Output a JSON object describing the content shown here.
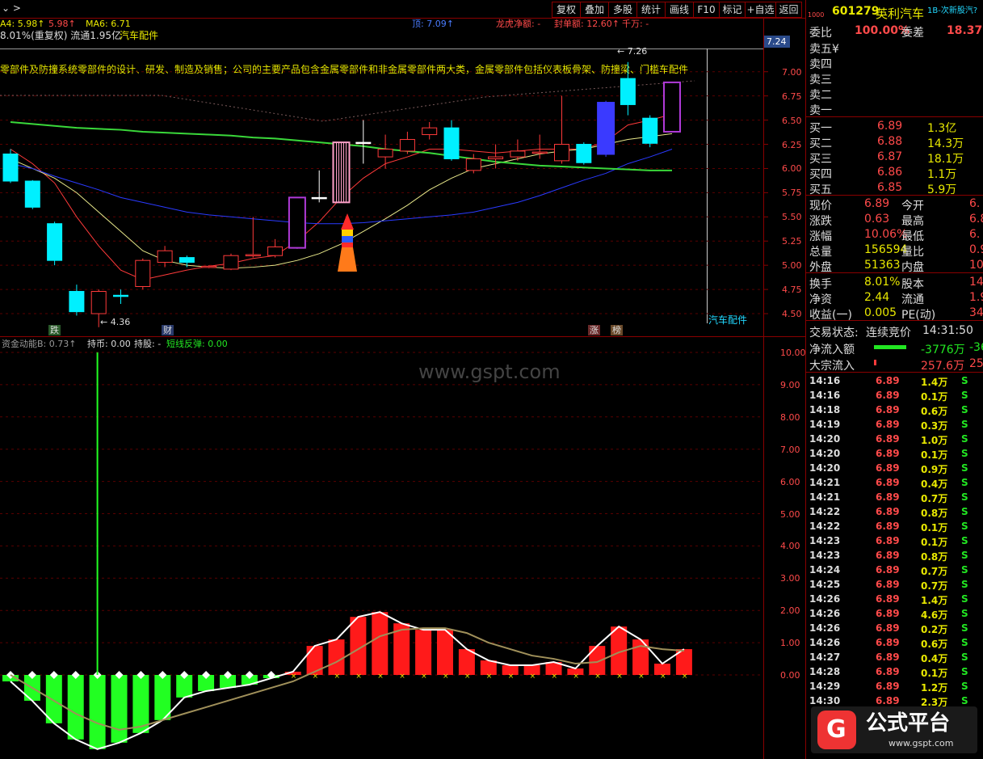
{
  "toolbar": {
    "arrow": "⌄ >",
    "buttons": [
      "复权",
      "叠加",
      "多股",
      "统计",
      "画线",
      "F10",
      "标记",
      "+自选",
      "返回"
    ]
  },
  "kline_header": {
    "ma4": "A4: 5.98↑",
    "val2": "5.98↑",
    "ma6": "MA6: 6.71",
    "ding": "顶: 7.09↑",
    "longhu": "龙虎净额: -",
    "fengdan": "封单额: 12.60↑",
    "qianwan": "千万: -",
    "turnover_line": "8.01%(重复权) 流通1.95亿",
    "sector": "汽车配件",
    "marker_top": "7.24",
    "high_label": "7.26",
    "low_label": "4.36",
    "sector_bottom": "汽车配件"
  },
  "scrolling_text": "零部件及防撞系统零部件的设计、研发、制造及销售；公司的主要产品包含金属零部件和非金属零部件两大类，金属零部件包括仪表板骨架、防撞梁、门槛车配件",
  "price_axis": [
    "7.00",
    "6.75",
    "6.50",
    "6.25",
    "6.00",
    "5.75",
    "5.50",
    "5.25",
    "5.00",
    "4.75",
    "4.50"
  ],
  "event_tags": {
    "die": "跌",
    "cai": "财",
    "zhang": "涨",
    "bang": "榜"
  },
  "indicator_header": {
    "name": "资金动能B: 0.73↑",
    "chibi": "持币: 0.00",
    "chigu": "持股: -",
    "duanxian": "短线反弹: 0.00"
  },
  "indicator_axis": [
    "10.00",
    "9.00",
    "8.00",
    "7.00",
    "6.00",
    "5.00",
    "4.00",
    "3.00",
    "2.00",
    "1.00",
    "0.00"
  ],
  "watermark": "www.gspt.com",
  "quote": {
    "code": "601279",
    "name": "英利汽车",
    "tag": "1B-次新股汽?",
    "prefix": "1000",
    "weibi_label": "委比",
    "weibi": "100.00%",
    "weicha_label": "委差",
    "weicha": "18.37",
    "sell": [
      "卖五¥",
      "卖四",
      "卖三",
      "卖二",
      "卖一"
    ],
    "buy": [
      {
        "label": "买一",
        "price": "6.89",
        "vol": "1.3亿"
      },
      {
        "label": "买二",
        "price": "6.88",
        "vol": "14.3万"
      },
      {
        "label": "买三",
        "price": "6.87",
        "vol": "18.1万"
      },
      {
        "label": "买四",
        "price": "6.86",
        "vol": "1.1万"
      },
      {
        "label": "买五",
        "price": "6.85",
        "vol": "5.9万"
      }
    ],
    "stats": [
      {
        "l1": "现价",
        "v1": "6.89",
        "l2": "今开",
        "v2": "6."
      },
      {
        "l1": "涨跌",
        "v1": "0.63",
        "l2": "最高",
        "v2": "6.8"
      },
      {
        "l1": "涨幅",
        "v1": "10.06%",
        "l2": "最低",
        "v2": "6."
      },
      {
        "l1": "总量",
        "v1": "156594",
        "l2": "量比",
        "v2": "0.9"
      },
      {
        "l1": "外盘",
        "v1": "51363",
        "l2": "内盘",
        "v2": "10523"
      }
    ],
    "stats2": [
      {
        "l1": "换手",
        "v1": "8.01%",
        "l2": "股本",
        "v2": "14.9"
      },
      {
        "l1": "净资",
        "v1": "2.44",
        "l2": "流通",
        "v2": "1.95"
      },
      {
        "l1": "收益(一)",
        "v1": "0.005",
        "l2": "PE(动)",
        "v2": "349"
      }
    ],
    "trade_status_label": "交易状态:",
    "trade_status": "连续竞价",
    "trade_time": "14:31:50",
    "netflow_label": "净流入额",
    "netflow": "-3776万",
    "netflow2": "-36",
    "block_label": "大宗流入",
    "block": "257.6万",
    "block2": "25"
  },
  "ticks": [
    {
      "t": "14:16",
      "p": "6.89",
      "v": "1.4万",
      "s": "S"
    },
    {
      "t": "14:16",
      "p": "6.89",
      "v": "0.1万",
      "s": "S"
    },
    {
      "t": "14:18",
      "p": "6.89",
      "v": "0.6万",
      "s": "S"
    },
    {
      "t": "14:19",
      "p": "6.89",
      "v": "0.3万",
      "s": "S"
    },
    {
      "t": "14:20",
      "p": "6.89",
      "v": "1.0万",
      "s": "S"
    },
    {
      "t": "14:20",
      "p": "6.89",
      "v": "0.1万",
      "s": "S"
    },
    {
      "t": "14:20",
      "p": "6.89",
      "v": "0.9万",
      "s": "S"
    },
    {
      "t": "14:21",
      "p": "6.89",
      "v": "0.4万",
      "s": "S"
    },
    {
      "t": "14:21",
      "p": "6.89",
      "v": "0.7万",
      "s": "S"
    },
    {
      "t": "14:22",
      "p": "6.89",
      "v": "0.8万",
      "s": "S"
    },
    {
      "t": "14:22",
      "p": "6.89",
      "v": "0.1万",
      "s": "S"
    },
    {
      "t": "14:23",
      "p": "6.89",
      "v": "0.1万",
      "s": "S"
    },
    {
      "t": "14:23",
      "p": "6.89",
      "v": "0.8万",
      "s": "S"
    },
    {
      "t": "14:24",
      "p": "6.89",
      "v": "0.7万",
      "s": "S"
    },
    {
      "t": "14:25",
      "p": "6.89",
      "v": "0.7万",
      "s": "S"
    },
    {
      "t": "14:26",
      "p": "6.89",
      "v": "1.4万",
      "s": "S"
    },
    {
      "t": "14:26",
      "p": "6.89",
      "v": "4.6万",
      "s": "S"
    },
    {
      "t": "14:26",
      "p": "6.89",
      "v": "0.2万",
      "s": "S"
    },
    {
      "t": "14:26",
      "p": "6.89",
      "v": "0.6万",
      "s": "S"
    },
    {
      "t": "14:27",
      "p": "6.89",
      "v": "0.4万",
      "s": "S"
    },
    {
      "t": "14:28",
      "p": "6.89",
      "v": "0.1万",
      "s": "S"
    },
    {
      "t": "14:29",
      "p": "6.89",
      "v": "1.2万",
      "s": "S"
    },
    {
      "t": "14:30",
      "p": "6.89",
      "v": "2.3万",
      "s": "S"
    }
  ],
  "logo": {
    "name": "公式平台",
    "url": "www.gspt.com"
  },
  "candles": [
    {
      "o": 6.15,
      "c": 5.87,
      "h": 6.2,
      "l": 5.85,
      "col": "cyan"
    },
    {
      "o": 5.87,
      "c": 5.6,
      "h": 5.88,
      "l": 5.58,
      "col": "cyan"
    },
    {
      "o": 5.43,
      "c": 5.05,
      "h": 5.45,
      "l": 5.0,
      "col": "cyan"
    },
    {
      "o": 4.73,
      "c": 4.52,
      "h": 4.8,
      "l": 4.48,
      "col": "cyan"
    },
    {
      "o": 4.5,
      "c": 4.73,
      "h": 4.75,
      "l": 4.36,
      "col": "red"
    },
    {
      "o": 4.69,
      "c": 4.69,
      "h": 4.75,
      "l": 4.6,
      "col": "cyan"
    },
    {
      "o": 4.78,
      "c": 5.05,
      "h": 5.07,
      "l": 4.75,
      "col": "red"
    },
    {
      "o": 5.03,
      "c": 5.15,
      "h": 5.2,
      "l": 4.98,
      "col": "red"
    },
    {
      "o": 5.08,
      "c": 5.03,
      "h": 5.1,
      "l": 4.98,
      "col": "cyan"
    },
    {
      "o": 4.99,
      "c": 4.99,
      "h": 5.0,
      "l": 4.97,
      "col": "red"
    },
    {
      "o": 4.96,
      "c": 5.1,
      "h": 5.12,
      "l": 4.95,
      "col": "red"
    },
    {
      "o": 5.1,
      "c": 5.11,
      "h": 5.5,
      "l": 5.08,
      "col": "red"
    },
    {
      "o": 5.1,
      "c": 5.19,
      "h": 5.27,
      "l": 5.08,
      "col": "red"
    },
    {
      "o": 5.18,
      "c": 5.7,
      "h": 5.7,
      "l": 5.17,
      "col": "purple"
    },
    {
      "o": 5.7,
      "c": 5.7,
      "h": 5.98,
      "l": 5.65,
      "col": "white"
    },
    {
      "o": 5.65,
      "c": 6.27,
      "h": 6.27,
      "l": 5.65,
      "col": "pink"
    },
    {
      "o": 6.27,
      "c": 6.27,
      "h": 6.5,
      "l": 6.05,
      "col": "white"
    },
    {
      "o": 6.12,
      "c": 6.2,
      "h": 6.35,
      "l": 6.0,
      "col": "red"
    },
    {
      "o": 6.18,
      "c": 6.3,
      "h": 6.38,
      "l": 6.15,
      "col": "red"
    },
    {
      "o": 6.35,
      "c": 6.42,
      "h": 6.48,
      "l": 6.3,
      "col": "red"
    },
    {
      "o": 6.42,
      "c": 6.1,
      "h": 6.5,
      "l": 6.08,
      "col": "cyan"
    },
    {
      "o": 5.98,
      "c": 6.1,
      "h": 6.15,
      "l": 5.95,
      "col": "red"
    },
    {
      "o": 6.1,
      "c": 6.12,
      "h": 6.25,
      "l": 6.0,
      "col": "red"
    },
    {
      "o": 6.12,
      "c": 6.18,
      "h": 6.3,
      "l": 6.08,
      "col": "red"
    },
    {
      "o": 6.17,
      "c": 6.17,
      "h": 6.35,
      "l": 6.1,
      "col": "red"
    },
    {
      "o": 6.08,
      "c": 6.25,
      "h": 6.75,
      "l": 6.05,
      "col": "red"
    },
    {
      "o": 6.25,
      "c": 6.06,
      "h": 6.27,
      "l": 6.04,
      "col": "cyan"
    },
    {
      "o": 6.15,
      "c": 6.68,
      "h": 6.7,
      "l": 6.12,
      "col": "blue"
    },
    {
      "o": 6.93,
      "c": 6.66,
      "h": 7.1,
      "l": 6.55,
      "col": "cyan"
    },
    {
      "o": 6.52,
      "c": 6.26,
      "h": 6.55,
      "l": 6.22,
      "col": "cyan"
    },
    {
      "o": 6.38,
      "c": 6.89,
      "h": 6.89,
      "l": 6.38,
      "col": "purple"
    }
  ],
  "ma_lines": {
    "ma5": [
      6.2,
      6.05,
      5.85,
      5.5,
      5.2,
      4.95,
      4.85,
      4.9,
      4.95,
      4.99,
      5.02,
      5.07,
      5.1,
      5.25,
      5.45,
      5.7,
      5.9,
      6.05,
      6.12,
      6.2,
      6.2,
      6.18,
      6.16,
      6.18,
      6.2,
      6.2,
      6.2,
      6.28,
      6.45,
      6.5,
      6.56
    ],
    "ma10": [
      6.1,
      6.0,
      5.9,
      5.75,
      5.55,
      5.35,
      5.15,
      5.05,
      5.0,
      4.98,
      4.97,
      4.98,
      5.0,
      5.05,
      5.12,
      5.22,
      5.35,
      5.48,
      5.62,
      5.78,
      5.9,
      6.0,
      6.05,
      6.1,
      6.15,
      6.18,
      6.2,
      6.25,
      6.3,
      6.33,
      6.36
    ],
    "ma20": [
      6.05,
      6.0,
      5.92,
      5.85,
      5.78,
      5.7,
      5.65,
      5.6,
      5.55,
      5.52,
      5.5,
      5.48,
      5.46,
      5.44,
      5.43,
      5.43,
      5.44,
      5.46,
      5.48,
      5.5,
      5.52,
      5.55,
      5.6,
      5.65,
      5.72,
      5.8,
      5.88,
      5.95,
      6.05,
      6.12,
      6.2
    ],
    "ma60": [
      6.48,
      6.46,
      6.44,
      6.42,
      6.41,
      6.4,
      6.38,
      6.37,
      6.36,
      6.35,
      6.34,
      6.32,
      6.31,
      6.29,
      6.27,
      6.25,
      6.23,
      6.2,
      6.18,
      6.16,
      6.13,
      6.1,
      6.07,
      6.05,
      6.03,
      6.02,
      6.01,
      6.0,
      5.99,
      5.98,
      5.98
    ]
  },
  "indicator": {
    "bars": [
      -0.2,
      -0.8,
      -1.5,
      -2.0,
      -2.3,
      -2.1,
      -1.8,
      -1.4,
      -0.7,
      -0.5,
      -0.4,
      -0.3,
      -0.1,
      0.1,
      0.9,
      1.1,
      1.8,
      1.95,
      1.6,
      1.4,
      1.4,
      0.8,
      0.45,
      0.3,
      0.3,
      0.4,
      0.2,
      0.9,
      1.5,
      1.1,
      0.35,
      0.8
    ],
    "avg": [
      0.0,
      -0.4,
      -0.8,
      -1.2,
      -1.5,
      -1.7,
      -1.6,
      -1.4,
      -1.2,
      -1.0,
      -0.8,
      -0.6,
      -0.4,
      -0.2,
      0.1,
      0.4,
      0.8,
      1.2,
      1.4,
      1.45,
      1.45,
      1.3,
      1.0,
      0.8,
      0.6,
      0.5,
      0.35,
      0.4,
      0.7,
      0.9,
      0.8,
      0.75
    ],
    "spike": 10.0
  }
}
